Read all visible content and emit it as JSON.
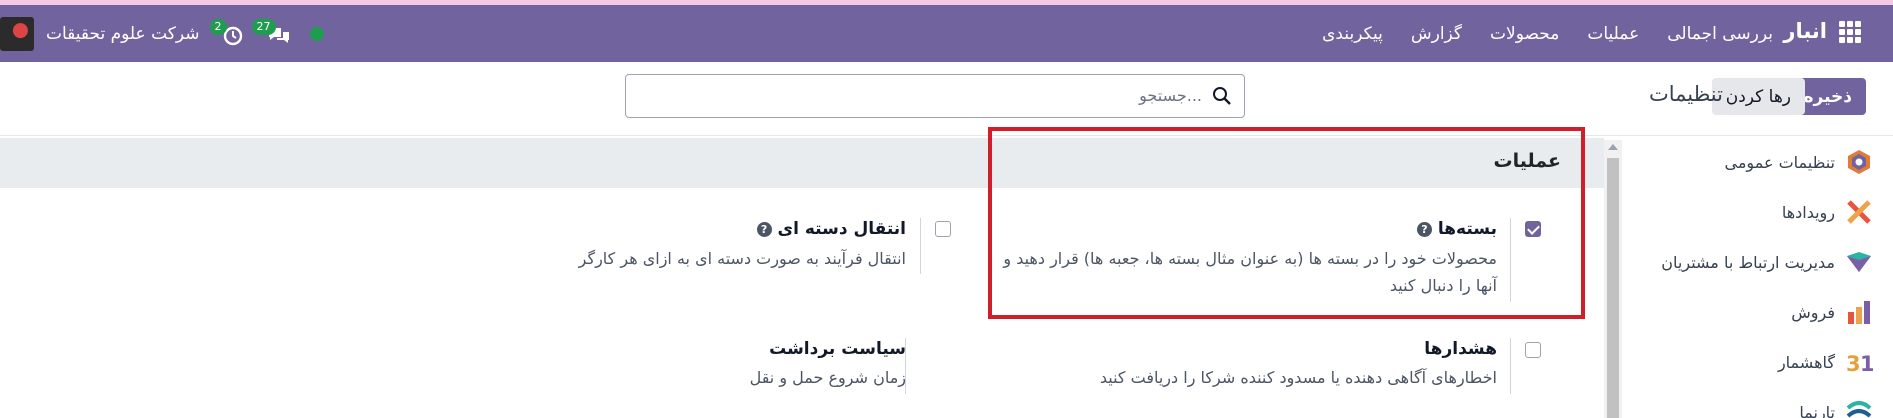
{
  "navbar": {
    "brand": "انبار",
    "menu": [
      "بررسی اجمالی",
      "عملیات",
      "محصولات",
      "گزارش",
      "پیکربندی"
    ],
    "company": "شرکت علوم تحقیقات",
    "activity_count": "2",
    "messages_count": "27"
  },
  "control": {
    "save_label": "ذخیره",
    "discard_label": "رها کردن",
    "title": "تنظیمات",
    "search_placeholder": "جستجو..."
  },
  "apps": [
    {
      "label": "تنظیمات عمومی",
      "icon": "general-settings-icon"
    },
    {
      "label": "رویدادها",
      "icon": "events-icon"
    },
    {
      "label": "مدیریت ارتباط با مشتریان",
      "icon": "crm-icon"
    },
    {
      "label": "فروش",
      "icon": "sales-icon"
    },
    {
      "label": "گاهشمار",
      "icon": "calendar-icon"
    },
    {
      "label": "تارنما",
      "icon": "website-icon"
    }
  ],
  "section": {
    "title": "عملیات"
  },
  "settings": {
    "packages": {
      "label": "بسته‌ها",
      "desc": "محصولات خود را در بسته ها (به عنوان مثال بسته ها، جعبه ها) قرار دهید و آنها را دنبال کنید",
      "checked": true
    },
    "batch_transfer": {
      "label": "انتقال دسته ای",
      "desc": "انتقال فرآیند به صورت دسته ای به ازای هر کارگر",
      "checked": false
    },
    "warnings": {
      "label": "هشدارها",
      "desc": "اخطارهای آگاهی دهنده یا مسدود کننده شرکا را دریافت کنید",
      "checked": false
    },
    "removal_policy": {
      "label": "سیاست برداشت",
      "desc": "زمان شروع حمل و نقل"
    }
  },
  "colors": {
    "brand": "#71639e",
    "highlight": "#d01f2a",
    "badge": "#1f9d4f"
  }
}
